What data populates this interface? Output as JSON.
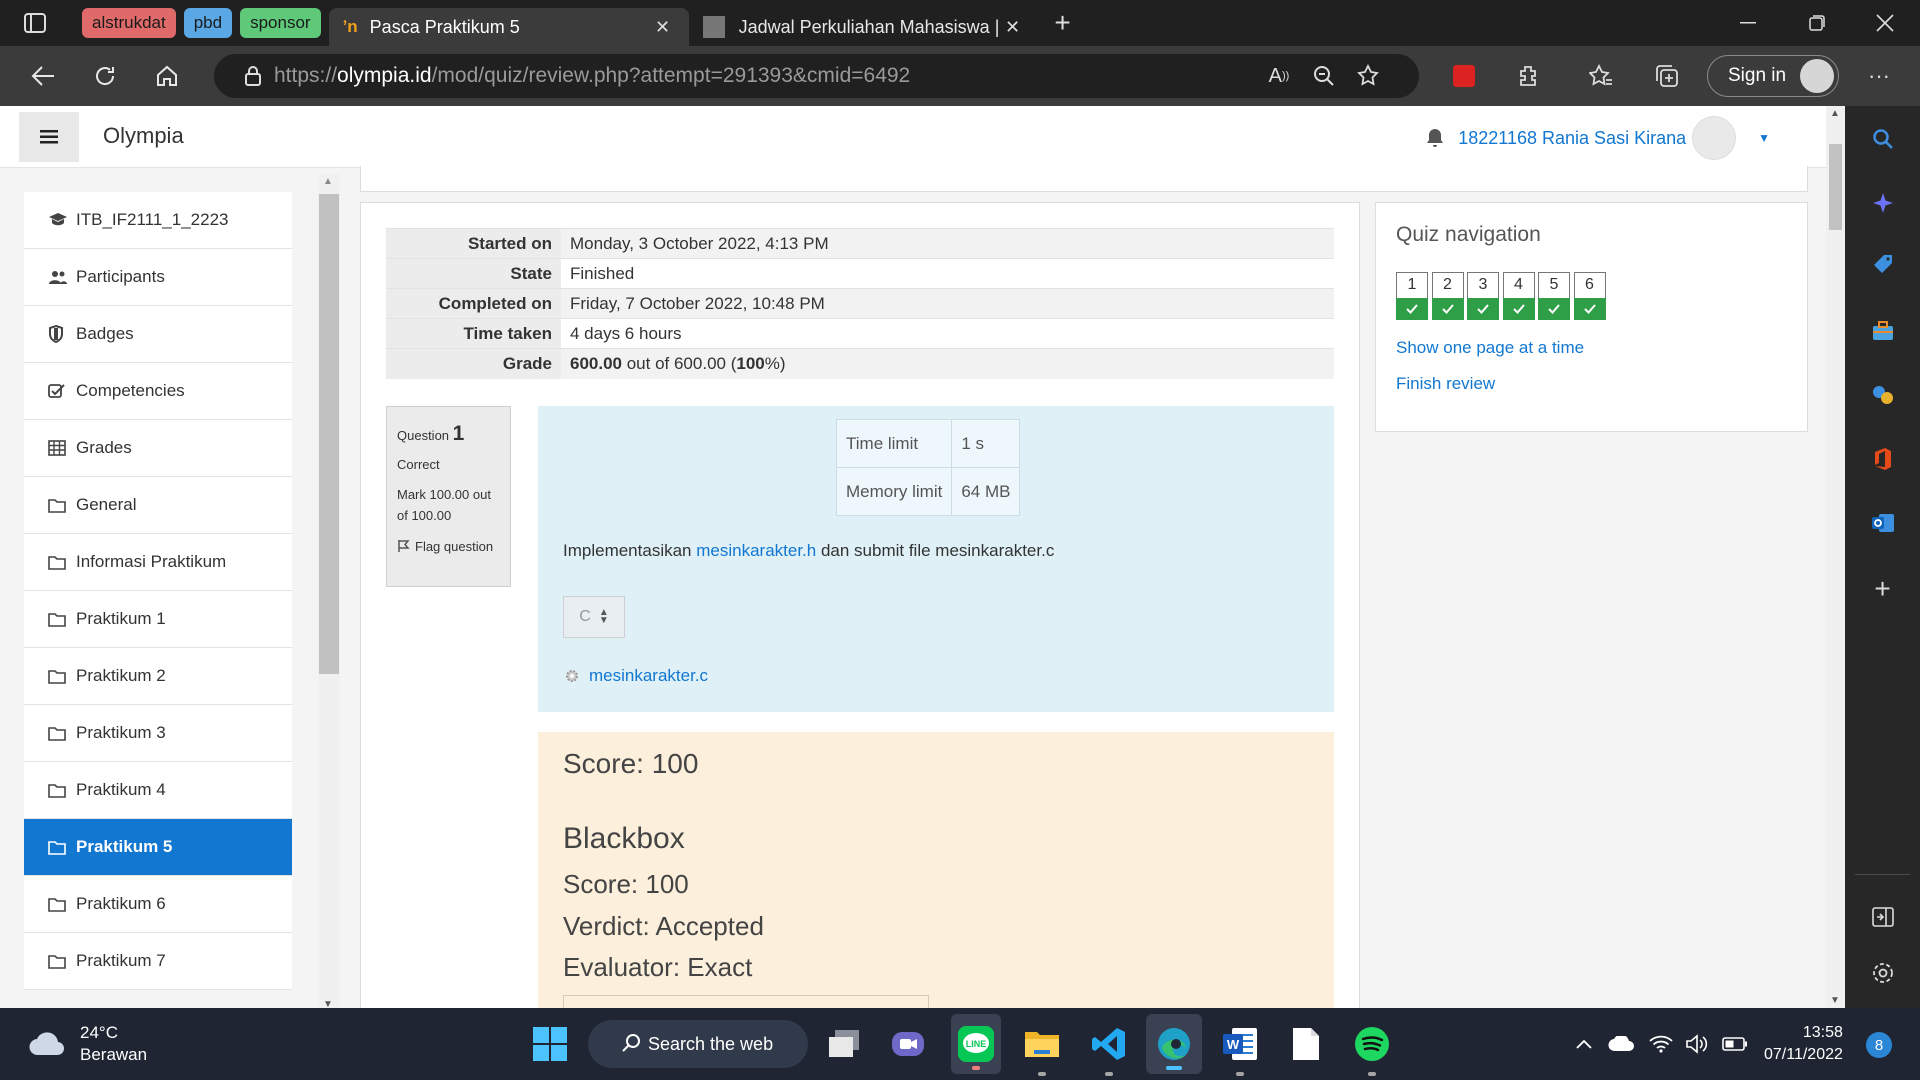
{
  "browser": {
    "tab_groups": [
      {
        "label": "alstrukdat",
        "color": "#e06a6a"
      },
      {
        "label": "pbd",
        "color": "#5aa7e6"
      },
      {
        "label": "sponsor",
        "color": "#5fc97a"
      }
    ],
    "tabs": [
      {
        "title": "Pasca Praktikum 5",
        "active": true
      },
      {
        "title": "Jadwal Perkuliahan Mahasiswa | S",
        "active": false
      }
    ],
    "url_prefix": "https://",
    "url_host": "olympia.id",
    "url_path": "/mod/quiz/review.php?attempt=291393&cmid=6492",
    "signin_label": "Sign in"
  },
  "site": {
    "brand": "Olympia",
    "user_name": "18221168 Rania Sasi Kirana"
  },
  "drawer": {
    "items": [
      {
        "label": "ITB_IF2111_1_2223",
        "icon": "graduation-cap-icon"
      },
      {
        "label": "Participants",
        "icon": "users-icon"
      },
      {
        "label": "Badges",
        "icon": "shield-icon"
      },
      {
        "label": "Competencies",
        "icon": "checkbox-icon"
      },
      {
        "label": "Grades",
        "icon": "table-icon"
      },
      {
        "label": "General",
        "icon": "folder-icon"
      },
      {
        "label": "Informasi Praktikum",
        "icon": "folder-icon"
      },
      {
        "label": "Praktikum 1",
        "icon": "folder-icon"
      },
      {
        "label": "Praktikum 2",
        "icon": "folder-icon"
      },
      {
        "label": "Praktikum 3",
        "icon": "folder-icon"
      },
      {
        "label": "Praktikum 4",
        "icon": "folder-icon"
      },
      {
        "label": "Praktikum 5",
        "icon": "folder-icon",
        "active": true
      },
      {
        "label": "Praktikum 6",
        "icon": "folder-icon"
      },
      {
        "label": "Praktikum 7",
        "icon": "folder-icon"
      }
    ]
  },
  "summary": {
    "rows": [
      {
        "key": "Started on",
        "value": "Monday, 3 October 2022, 4:13 PM"
      },
      {
        "key": "State",
        "value": "Finished"
      },
      {
        "key": "Completed on",
        "value": "Friday, 7 October 2022, 10:48 PM"
      },
      {
        "key": "Time taken",
        "value": "4 days 6 hours"
      }
    ],
    "grade_key": "Grade",
    "grade_score": "600.00",
    "grade_mid": " out of 600.00 (",
    "grade_pct": "100",
    "grade_end": "%)"
  },
  "question": {
    "label": "Question",
    "number": "1",
    "status": "Correct",
    "mark": "Mark 100.00 out of 100.00",
    "flag": "Flag question",
    "limits": [
      {
        "key": "Time limit",
        "value": "1 s"
      },
      {
        "key": "Memory limit",
        "value": "64 MB"
      }
    ],
    "desc_before": "Implementasikan ",
    "desc_link": "mesinkarakter.h",
    "desc_after": " dan submit file mesinkarakter.c",
    "language": "C",
    "file": "mesinkarakter.c"
  },
  "feedback": {
    "score": "Score: 100",
    "section": "Blackbox",
    "section_score": "Score: 100",
    "verdict": "Verdict: Accepted",
    "evaluator": "Evaluator: Exact"
  },
  "quiz_nav": {
    "title": "Quiz navigation",
    "questions": [
      "1",
      "2",
      "3",
      "4",
      "5",
      "6"
    ],
    "show_one_page": "Show one page at a time",
    "finish_review": "Finish review"
  },
  "taskbar": {
    "temperature": "24°C",
    "weather": "Berawan",
    "search": "Search the web",
    "time": "13:58",
    "date": "07/11/2022",
    "notifications": "8"
  }
}
